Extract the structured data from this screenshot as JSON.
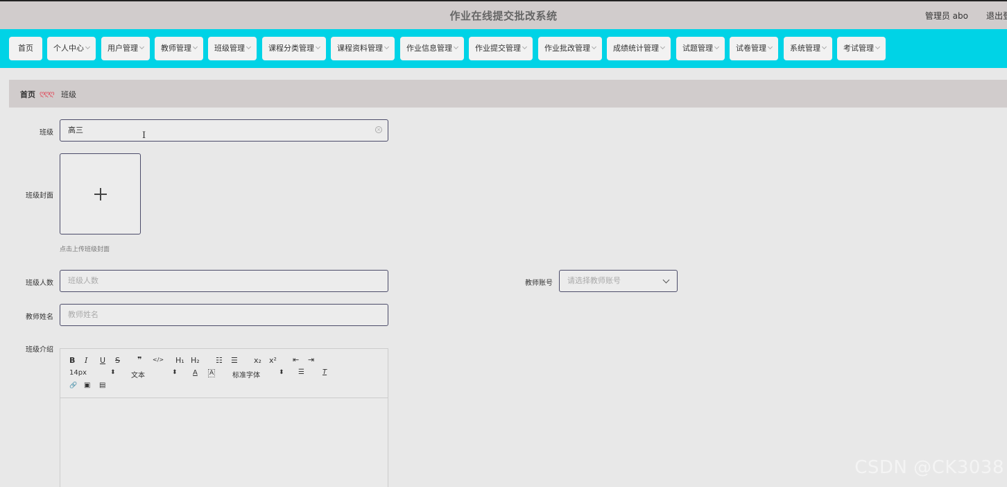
{
  "header": {
    "title": "作业在线提交批改系统",
    "user": "管理员 abo",
    "logout": "退出登"
  },
  "nav": {
    "items": [
      {
        "label": "首页"
      },
      {
        "label": "个人中心"
      },
      {
        "label": "用户管理"
      },
      {
        "label": "教师管理"
      },
      {
        "label": "班级管理"
      },
      {
        "label": "课程分类管理"
      },
      {
        "label": "课程资料管理"
      },
      {
        "label": "作业信息管理"
      },
      {
        "label": "作业提交管理"
      },
      {
        "label": "作业批改管理"
      },
      {
        "label": "成绩统计管理"
      },
      {
        "label": "试题管理"
      },
      {
        "label": "试卷管理"
      },
      {
        "label": "系统管理"
      },
      {
        "label": "考试管理"
      }
    ]
  },
  "breadcrumb": {
    "home": "首页",
    "separator": "ღღღ",
    "current": "班级"
  },
  "form": {
    "class_label": "班级",
    "class_value": "高三",
    "cover_label": "班级封面",
    "cover_hint": "点击上传班级封面",
    "count_label": "班级人数",
    "count_placeholder": "班级人数",
    "teacher_account_label": "教师账号",
    "teacher_account_placeholder": "请选择教师账号",
    "teacher_name_label": "教师姓名",
    "teacher_name_placeholder": "教师姓名",
    "intro_label": "班级介绍"
  },
  "editor": {
    "bold": "B",
    "italic": "I",
    "underline": "U",
    "strike": "S",
    "quote": "❞",
    "code": "</>",
    "h1": "H₁",
    "h2": "H₂",
    "ordered_list": "☷",
    "bullet_list": "☰",
    "subscript": "x₂",
    "superscript": "x²",
    "outdent": "⇤",
    "indent": "⇥",
    "size": "14px",
    "size_arrow": "⬍",
    "style": "文本",
    "style_arrow": "⬍",
    "font_color": "A",
    "bg_color": "A",
    "font": "标准字体",
    "font_arrow": "⬍",
    "align": "☰",
    "clear": "T",
    "link": "🔗",
    "image": "▣",
    "video": "▤"
  },
  "watermark": "CSDN @CK3038"
}
